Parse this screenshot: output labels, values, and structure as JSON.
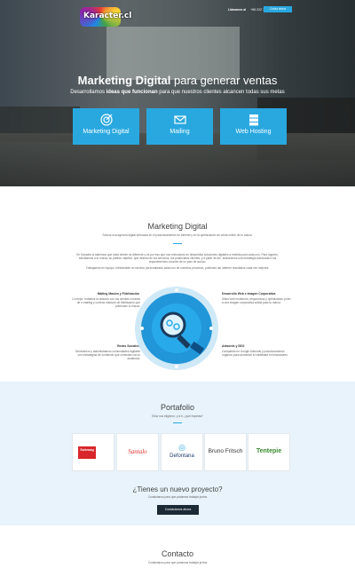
{
  "header": {
    "logo_text": "Karacter.cl",
    "email": "Llámanos al",
    "phone": "+56 222 795 668",
    "quote_button": "Cotiza ahora"
  },
  "hero": {
    "title_bold": "Marketing Digital",
    "title_rest": " para generar ventas",
    "subtitle_pre": "Desarrollamos ",
    "subtitle_bold": "ideas que funcionan",
    "subtitle_post": " para que nuestros clientes alcancen todas sus metas",
    "services": [
      {
        "label": "Marketing Digital",
        "icon": "target-icon"
      },
      {
        "label": "Mailing",
        "icon": "envelope-icon"
      },
      {
        "label": "Web Hosting",
        "icon": "server-icon"
      }
    ]
  },
  "marketing": {
    "title": "Marketing Digital",
    "subtitle": "Somos una agencia digital enfocada en el posicionamiento en internet y en la optimización de venta online de tu marca.",
    "para1": "En Karacter.cl sabemos que cada cliente es diferente y es por eso que nos enfocamos en desarrollar soluciones digitales a medida para cada uno. Para lograrlo, estudiamos a tu marca, su público objetivo, qué desean de tus servicios, tus potenciales clientes, y a partir de ahí, elaboramos una estrategia adecuada a tus requerimientos a través de un plan de acción.",
    "para2": "Trabajamos en equipo, brindándote un servicio personalizado cada uno de nuestros procesos, pudiendo así obtener resultados cada vez mejores.",
    "features": {
      "left_top_title": "Mailing Masivo y Fidelización",
      "left_top_text": "Lo mejor: fortalece la relación con tus clientes a través de e-mailing y correos masivos de fidelización que potencian tu marca.",
      "left_bottom_title": "Redes Sociales",
      "left_bottom_text": "Generamos y administramos comunidades digitales con estrategias de contenido que conectan con tu audiencia.",
      "right_top_title": "Desarrollo Web e Imagen Corporativa",
      "right_top_text": "Sitios web modernos, responsivos y optimizados, junto a una imagen corporativa sólida para tu marca.",
      "right_bottom_title": "Adwords y SEO",
      "right_bottom_text": "Campañas en Google Adwords y posicionamiento orgánico para aumentar tu visibilidad en buscadores."
    }
  },
  "portfolio": {
    "title": "Portafolio",
    "subtitle": "Ellos nos eligieron, y a tí, ¿qué esperas?",
    "clients": [
      {
        "name": "Sokmag",
        "color": "#d8262b"
      },
      {
        "name": "Santalo",
        "color": "#e0302a"
      },
      {
        "name": "Defontana",
        "color": "#1e3a6e"
      },
      {
        "name": "Bruno Fritsch",
        "color": "#333333"
      },
      {
        "name": "Tentepie",
        "color": "#3a8a2f"
      }
    ],
    "project_title": "¿Tienes un nuevo proyecto?",
    "project_subtitle": "Contáctanos para que podamos trabajar juntos",
    "contact_button": "Contáctanos ahora"
  },
  "contact": {
    "title": "Contacto",
    "subtitle": "Contáctanos para que podamos trabajar juntos"
  },
  "colors": {
    "accent": "#29a8e0",
    "dark": "#1c2a36",
    "portfolio_bg": "#e8f3fb"
  }
}
